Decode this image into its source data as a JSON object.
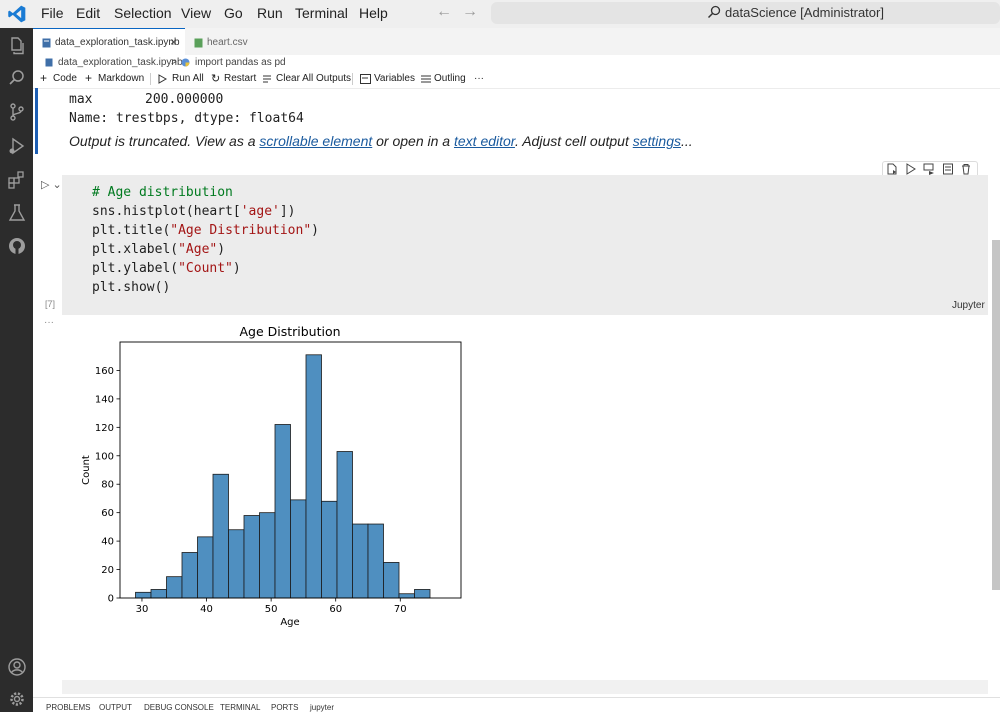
{
  "titlebar": {
    "menu": [
      "File",
      "Edit",
      "Selection",
      "View",
      "Go",
      "Run",
      "Terminal",
      "Help"
    ],
    "search_text": "dataScience [Administrator]",
    "accent_color": "#0a66c2"
  },
  "activity_icons": [
    "explorer-icon",
    "search-icon",
    "source-control-icon",
    "run-debug-icon",
    "extensions-icon",
    "testing-icon",
    "github-icon",
    "account-icon",
    "settings-gear-icon"
  ],
  "tabs": [
    {
      "label": "data_exploration_task.ipynb",
      "active": true,
      "close": "×"
    },
    {
      "label": "heart.csv",
      "active": false
    }
  ],
  "breadcrumb": {
    "file": "data_exploration_task.ipynb",
    "separator": ">",
    "cell": "import pandas as pd"
  },
  "toolbar": {
    "code": "Code",
    "markdown": "Markdown",
    "run_all": "Run All",
    "restart": "Restart",
    "clear_outputs": "Clear All Outputs",
    "variables": "Variables",
    "outline": "Outling",
    "more": "···"
  },
  "output_text": {
    "max_label": "max",
    "max_value": "200.000000",
    "name_line": "Name: trestbps, dtype: float64",
    "trunc_1": "Output is truncated. View as a ",
    "trunc_link1": "scrollable element",
    "trunc_2": " or open in a ",
    "trunc_link2": "text editor",
    "trunc_3": ". Adjust cell output ",
    "trunc_link3": "settings",
    "trunc_4": "..."
  },
  "cell": {
    "code_lines": [
      [
        {
          "t": "# Age distribution",
          "c": "c-com"
        }
      ],
      [
        {
          "t": "sns.histplot(heart[",
          "c": "c-def"
        },
        {
          "t": "'age'",
          "c": "c-str"
        },
        {
          "t": "])",
          "c": "c-def"
        }
      ],
      [
        {
          "t": "plt.title(",
          "c": "c-def"
        },
        {
          "t": "\"Age Distribution\"",
          "c": "c-str"
        },
        {
          "t": ")",
          "c": "c-def"
        }
      ],
      [
        {
          "t": "plt.xlabel(",
          "c": "c-def"
        },
        {
          "t": "\"Age\"",
          "c": "c-str"
        },
        {
          "t": ")",
          "c": "c-def"
        }
      ],
      [
        {
          "t": "plt.ylabel(",
          "c": "c-def"
        },
        {
          "t": "\"Count\"",
          "c": "c-str"
        },
        {
          "t": ")",
          "c": "c-def"
        }
      ],
      [
        {
          "t": "plt.show()",
          "c": "c-def"
        }
      ]
    ],
    "exec_count": "[7]",
    "kernel": "Jupyter",
    "output_more": "···"
  },
  "chart_data": {
    "type": "bar",
    "title": "Age Distribution",
    "xlabel": "Age",
    "ylabel": "Count",
    "bin_edges": [
      29,
      31.4,
      33.8,
      36.2,
      38.6,
      41,
      43.4,
      45.8,
      48.2,
      50.6,
      53,
      55.4,
      57.8,
      60.2,
      62.6,
      65,
      67.4,
      69.8,
      72.2,
      74.6,
      77
    ],
    "values": [
      4,
      6,
      15,
      32,
      43,
      87,
      48,
      58,
      60,
      122,
      69,
      171,
      68,
      103,
      52,
      52,
      25,
      3,
      6,
      0
    ],
    "xlim": [
      26.6,
      79.4
    ],
    "ylim": [
      0,
      180
    ],
    "xticks": [
      30,
      40,
      50,
      60,
      70
    ],
    "yticks": [
      0,
      20,
      40,
      60,
      80,
      100,
      120,
      140,
      160
    ],
    "bar_color": "#4f8fc0",
    "grid": false
  },
  "panel_tabs": [
    "PROBLEMS",
    "OUTPUT",
    "DEBUG CONSOLE",
    "TERMINAL",
    "PORTS",
    "jupyter"
  ]
}
